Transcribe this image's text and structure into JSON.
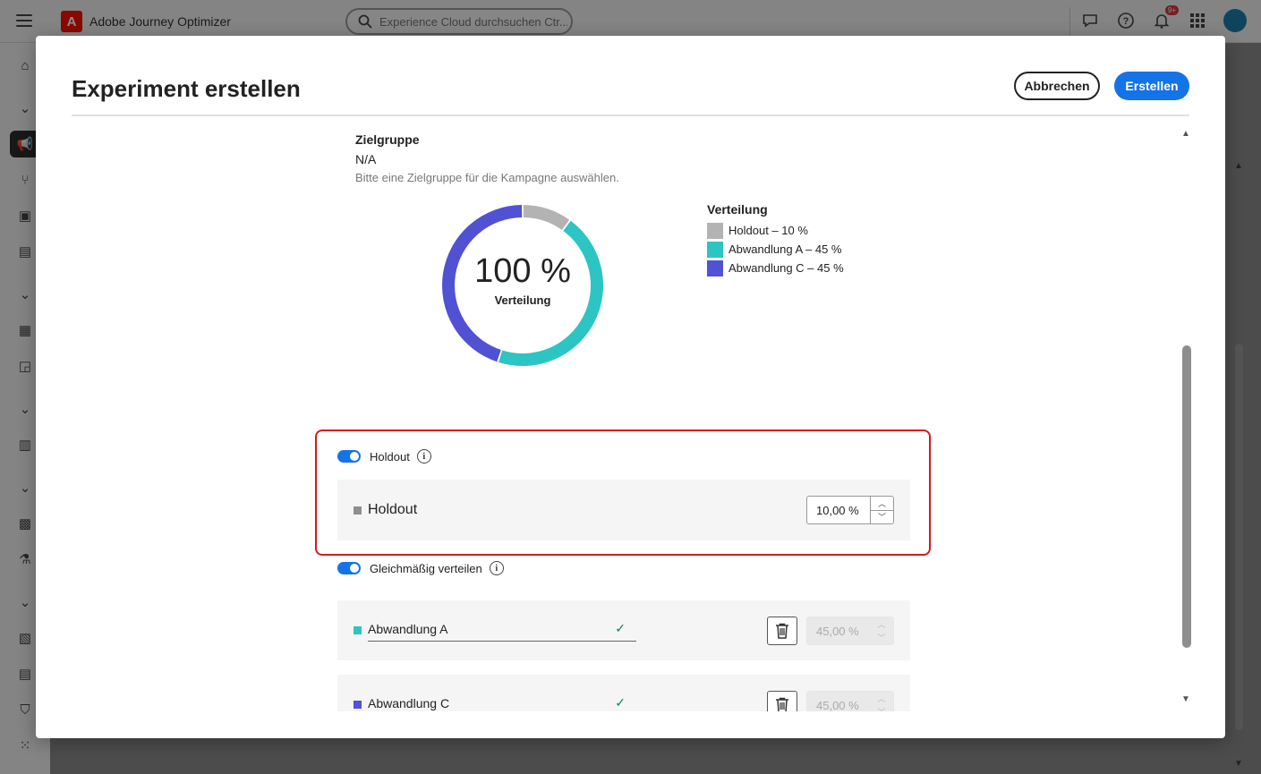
{
  "app": {
    "name": "Adobe Journey Optimizer",
    "search_placeholder": "Experience Cloud durchsuchen Ctr...",
    "notification_count": "9+"
  },
  "modal": {
    "title": "Experiment erstellen",
    "cancel_label": "Abbrechen",
    "create_label": "Erstellen"
  },
  "audience": {
    "label": "Zielgruppe",
    "value": "N/A",
    "hint": "Bitte eine Zielgruppe für die Kampagne auswählen."
  },
  "distribution_chart": {
    "center_value": "100 %",
    "center_label": "Verteilung",
    "legend_title": "Verteilung",
    "segments": [
      {
        "label": "Holdout – 10 %",
        "percent": 10,
        "color": "#b3b3b3"
      },
      {
        "label": "Abwandlung A – 45 %",
        "percent": 45,
        "color": "#2dc4c4"
      },
      {
        "label": "Abwandlung C – 45 %",
        "percent": 45,
        "color": "#5151d3"
      }
    ]
  },
  "holdout": {
    "toggle_label": "Holdout",
    "toggle_on": true,
    "row_name": "Holdout",
    "row_value": "10,00 %",
    "color": "#8f8f8f"
  },
  "even_split": {
    "toggle_label": "Gleichmäßig verteilen",
    "toggle_on": true
  },
  "variants": [
    {
      "name": "Abwandlung A",
      "value": "45,00 %",
      "color": "#2dc4c4"
    },
    {
      "name": "Abwandlung C",
      "value": "45,00 %",
      "color": "#5151d3"
    }
  ],
  "colors": {
    "accent": "#1473e6",
    "highlight": "#d7191c",
    "valid": "#12805c"
  }
}
